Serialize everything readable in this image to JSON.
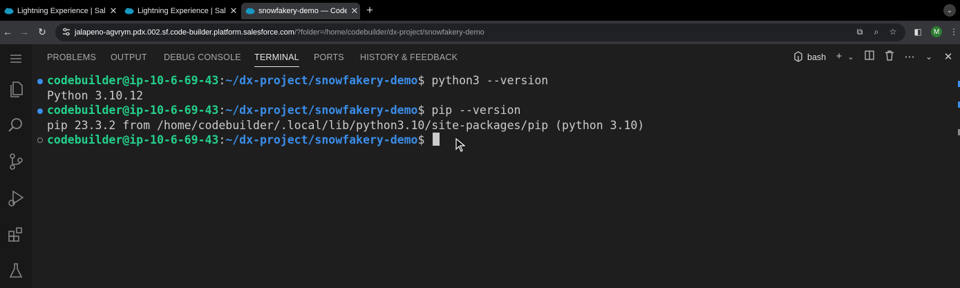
{
  "browser": {
    "tabs": [
      {
        "title": "Lightning Experience | Salesf",
        "active": false
      },
      {
        "title": "Lightning Experience | Salesf",
        "active": false
      },
      {
        "title": "snowfakery-demo — Code Bu",
        "active": true
      }
    ],
    "url_host": "jalapeno-agvrym.pdx.002.sf.code-builder.platform.salesforce.com",
    "url_path": "/?folder=/home/codebuilder/dx-project/snowfakery-demo",
    "avatar_initial": "M"
  },
  "panel": {
    "tabs": [
      "PROBLEMS",
      "OUTPUT",
      "DEBUG CONSOLE",
      "TERMINAL",
      "PORTS",
      "HISTORY & FEEDBACK"
    ],
    "active_tab": "TERMINAL",
    "shell_label": "bash"
  },
  "terminal": {
    "user_host": "codebuilder@ip-10-6-69-43",
    "path": "~/dx-project/snowfakery-demo",
    "cmd1": "python3 --version",
    "out1": "Python 3.10.12",
    "cmd2": "pip --version",
    "out2": "pip 23.3.2 from /home/codebuilder/.local/lib/python3.10/site-packages/pip (python 3.10)"
  },
  "colors": {
    "prompt_user": "#23d18b",
    "prompt_path": "#3b8eea",
    "success_dot": "#3b8eea"
  }
}
